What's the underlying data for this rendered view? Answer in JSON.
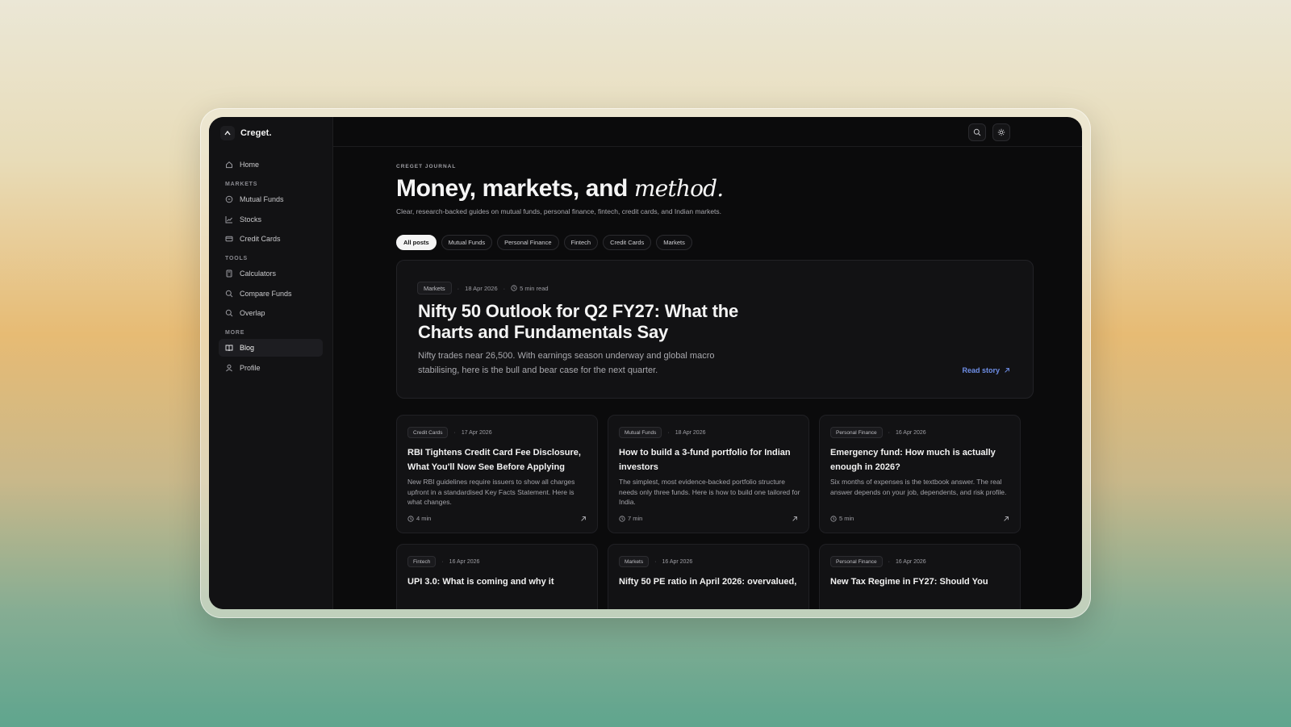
{
  "brand": {
    "name": "Creget."
  },
  "sidebar": {
    "home": "Home",
    "sections": [
      {
        "title": "MARKETS",
        "items": [
          {
            "label": "Mutual Funds",
            "icon": "coin-icon"
          },
          {
            "label": "Stocks",
            "icon": "chart-line-icon"
          },
          {
            "label": "Credit Cards",
            "icon": "credit-card-icon"
          }
        ]
      },
      {
        "title": "TOOLS",
        "items": [
          {
            "label": "Calculators",
            "icon": "calculator-icon"
          },
          {
            "label": "Compare Funds",
            "icon": "search-icon"
          },
          {
            "label": "Overlap",
            "icon": "search-icon"
          }
        ]
      },
      {
        "title": "MORE",
        "items": [
          {
            "label": "Blog",
            "icon": "book-icon",
            "active": true
          },
          {
            "label": "Profile",
            "icon": "user-icon"
          }
        ]
      }
    ]
  },
  "header": {
    "eyebrow": "CREGET JOURNAL",
    "title_main": "Money, markets, and ",
    "title_accent": "method.",
    "subtitle": "Clear, research-backed guides on mutual funds, personal finance, fintech, credit cards, and Indian markets."
  },
  "filters": [
    "All posts",
    "Mutual Funds",
    "Personal Finance",
    "Fintech",
    "Credit Cards",
    "Markets"
  ],
  "featured": {
    "tag": "Markets",
    "date": "18 Apr 2026",
    "read_time": "5 min read",
    "title": "Nifty 50 Outlook for Q2 FY27: What the Charts and Fundamentals Say",
    "description": "Nifty trades near 26,500. With earnings season underway and global macro stabilising, here is the bull and bear case for the next quarter.",
    "cta": "Read story"
  },
  "posts": [
    {
      "tag": "Credit Cards",
      "date": "17 Apr 2026",
      "title": "RBI Tightens Credit Card Fee Disclosure, What You'll Now See Before Applying",
      "description": "New RBI guidelines require issuers to show all charges upfront in a standardised Key Facts Statement. Here is what changes.",
      "read_time": "4 min"
    },
    {
      "tag": "Mutual Funds",
      "date": "18 Apr 2026",
      "title": "How to build a 3-fund portfolio for Indian investors",
      "description": "The simplest, most evidence-backed portfolio structure needs only three funds. Here is how to build one tailored for India.",
      "read_time": "7 min"
    },
    {
      "tag": "Personal Finance",
      "date": "16 Apr 2026",
      "title": "Emergency fund: How much is actually enough in 2026?",
      "description": "Six months of expenses is the textbook answer. The real answer depends on your job, dependents, and risk profile.",
      "read_time": "5 min"
    },
    {
      "tag": "Fintech",
      "date": "16 Apr 2026",
      "title": "UPI 3.0: What is coming and why it",
      "description": "",
      "read_time": ""
    },
    {
      "tag": "Markets",
      "date": "16 Apr 2026",
      "title": "Nifty 50 PE ratio in April 2026: overvalued,",
      "description": "",
      "read_time": ""
    },
    {
      "tag": "Personal Finance",
      "date": "16 Apr 2026",
      "title": "New Tax Regime in FY27: Should You",
      "description": "",
      "read_time": ""
    }
  ]
}
